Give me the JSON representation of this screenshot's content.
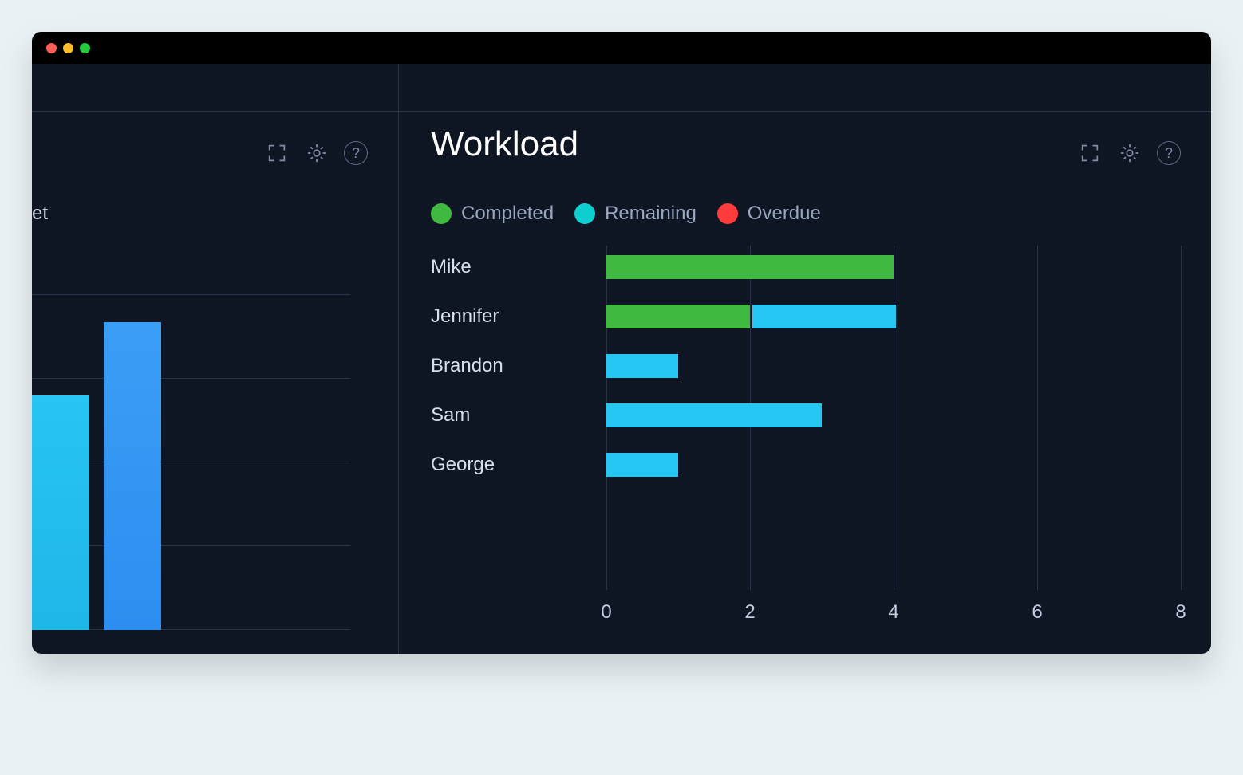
{
  "left_panel": {
    "label_fragment": "et"
  },
  "workload": {
    "title": "Workload",
    "legend": [
      {
        "label": "Completed",
        "color": "#3fb93f"
      },
      {
        "label": "Remaining",
        "color": "#0ecfcf"
      },
      {
        "label": "Overdue",
        "color": "#ff3b3b"
      }
    ],
    "x_ticks": [
      "0",
      "2",
      "4",
      "6",
      "8"
    ]
  },
  "chart_data": [
    {
      "type": "bar",
      "orientation": "horizontal",
      "title": "Workload",
      "xlabel": "",
      "ylabel": "",
      "xlim": [
        0,
        8
      ],
      "categories": [
        "Mike",
        "Jennifer",
        "Brandon",
        "Sam",
        "George"
      ],
      "series": [
        {
          "name": "Completed",
          "color": "#3fb93f",
          "values": [
            4,
            2,
            0,
            0,
            0
          ]
        },
        {
          "name": "Remaining",
          "color": "#26c6f2",
          "values": [
            0,
            2,
            1,
            3,
            1
          ]
        },
        {
          "name": "Overdue",
          "color": "#ff3b3b",
          "values": [
            0,
            0,
            0,
            0,
            0
          ]
        }
      ],
      "x_ticks": [
        0,
        2,
        4,
        6,
        8
      ]
    }
  ]
}
